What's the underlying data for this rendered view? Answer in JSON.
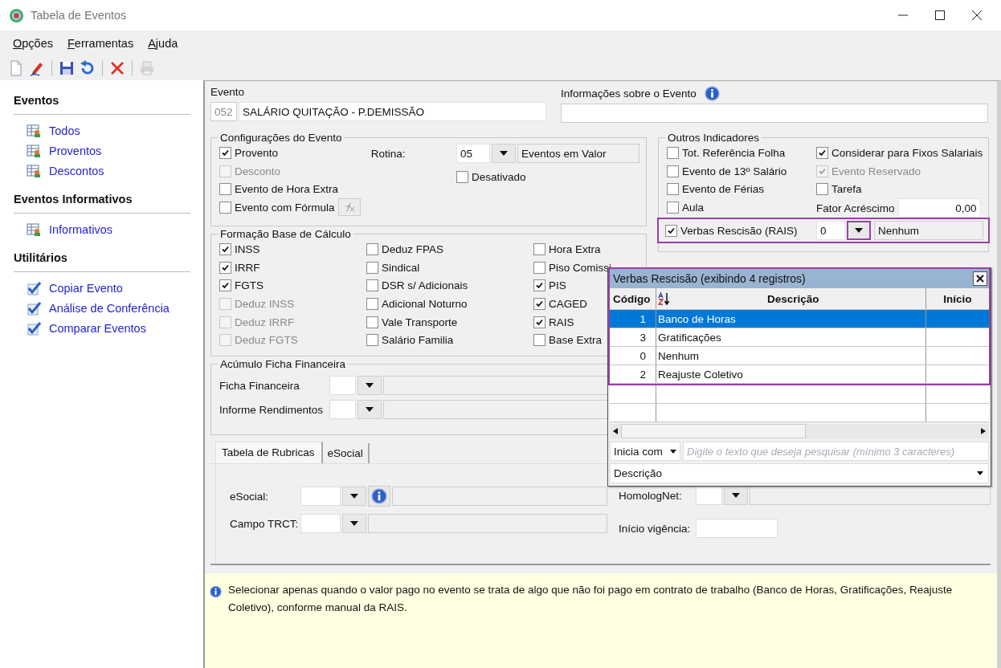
{
  "window": {
    "title": "Tabela de Eventos"
  },
  "menu": [
    "Opções",
    "Ferramentas",
    "Ajuda"
  ],
  "toolbar": [
    [
      {
        "kind": "new",
        "disabled": false
      },
      {
        "kind": "edit",
        "disabled": false
      }
    ],
    [
      {
        "kind": "save",
        "disabled": false
      },
      {
        "kind": "undo",
        "disabled": false
      }
    ],
    [
      {
        "kind": "delete",
        "disabled": false
      }
    ],
    [
      {
        "kind": "print",
        "disabled": true
      }
    ]
  ],
  "sidebar": [
    {
      "title": "Eventos",
      "items": [
        {
          "label": "Todos",
          "kind": "list"
        },
        {
          "label": "Proventos",
          "kind": "list"
        },
        {
          "label": "Descontos",
          "kind": "list"
        }
      ]
    },
    {
      "title": "Eventos Informativos",
      "items": [
        {
          "label": "Informativos",
          "kind": "list"
        }
      ]
    },
    {
      "title": "Utilitários",
      "items": [
        {
          "label": "Copiar Evento",
          "kind": "check"
        },
        {
          "label": "Análise de Conferência",
          "kind": "check"
        },
        {
          "label": "Comparar Eventos",
          "kind": "check"
        }
      ]
    }
  ],
  "evento": {
    "label": "Evento",
    "code": "052",
    "name": "SALÁRIO QUITAÇÃO - P.DEMISSÃO"
  },
  "info": {
    "label": "Informações sobre o Evento"
  },
  "config": {
    "title": "Configurações do Evento",
    "items": [
      {
        "label": "Provento",
        "checked": true,
        "disabled": false
      },
      {
        "label": "Desconto",
        "checked": false,
        "disabled": true
      },
      {
        "label": "Evento de Hora Extra",
        "checked": false,
        "disabled": false
      },
      {
        "label": "Evento com Fórmula",
        "checked": false,
        "disabled": false
      }
    ],
    "rotina": {
      "label": "Rotina:",
      "code": "05",
      "description": "Eventos em Valor"
    },
    "desativado": {
      "label": "Desativado",
      "checked": false,
      "disabled": false
    }
  },
  "base": {
    "title": "Formação Base de Cálculo",
    "columns": [
      [
        {
          "label": "INSS",
          "checked": true,
          "disabled": false
        },
        {
          "label": "IRRF",
          "checked": true,
          "disabled": false
        },
        {
          "label": "FGTS",
          "checked": true,
          "disabled": false
        },
        {
          "label": "Deduz INSS",
          "checked": false,
          "disabled": true
        },
        {
          "label": "Deduz IRRF",
          "checked": false,
          "disabled": true
        },
        {
          "label": "Deduz FGTS",
          "checked": false,
          "disabled": true
        }
      ],
      [
        {
          "label": "Deduz FPAS",
          "checked": false,
          "disabled": false
        },
        {
          "label": "Sindical",
          "checked": false,
          "disabled": false
        },
        {
          "label": "DSR s/ Adicionais",
          "checked": false,
          "disabled": false
        },
        {
          "label": "Adicional Noturno",
          "checked": false,
          "disabled": false
        },
        {
          "label": "Vale Transporte",
          "checked": false,
          "disabled": false
        },
        {
          "label": "Salário Familia",
          "checked": false,
          "disabled": false
        }
      ],
      [
        {
          "label": "Hora Extra",
          "checked": false,
          "disabled": false
        },
        {
          "label": "Piso Comissi",
          "checked": false,
          "disabled": false
        },
        {
          "label": "PIS",
          "checked": true,
          "disabled": false
        },
        {
          "label": "CAGED",
          "checked": true,
          "disabled": false
        },
        {
          "label": "RAIS",
          "checked": true,
          "disabled": false
        },
        {
          "label": "Base Extra",
          "checked": false,
          "disabled": false
        }
      ]
    ]
  },
  "acumulo": {
    "title": "Acúmulo Ficha Financeira",
    "rows": [
      {
        "label": "Ficha Financeira"
      },
      {
        "label": "Informe Rendimentos"
      }
    ]
  },
  "outros": {
    "title": "Outros Indicadores",
    "items": [
      {
        "label": "Tot. Referência Folha",
        "checked": false,
        "disabled": false
      },
      {
        "label": "Considerar para Fixos Salariais",
        "checked": true,
        "disabled": false
      },
      {
        "label": "Evento de 13º Salário",
        "checked": false,
        "disabled": false
      },
      {
        "label": "Evento Reservado",
        "checked": true,
        "disabled": true
      },
      {
        "label": "Evento de Férias",
        "checked": false,
        "disabled": false
      },
      {
        "label": "Tarefa",
        "checked": false,
        "disabled": false
      },
      {
        "label": "Aula",
        "checked": false,
        "disabled": false
      }
    ],
    "fator": {
      "label": "Fator Acréscimo",
      "value": "0,00"
    },
    "verbas": {
      "label": "Verbas Rescisão (RAIS)",
      "checked": true,
      "disabled": false,
      "code": "0",
      "description": "Nenhum",
      "highlighted": true
    }
  },
  "tabs": [
    {
      "label": "Tabela de Rubricas",
      "selected": true
    },
    {
      "label": "eSocial",
      "selected": false
    }
  ],
  "rubricas": {
    "esocial": "eSocial:",
    "trct": "Campo TRCT:",
    "homolognet": "HomologNet:",
    "vigencia": "Início vigência:"
  },
  "hint": "Selecionar apenas quando o valor pago no evento se trata de algo que não foi pago em contrato de trabalho (Banco de Horas, Gratificações, Reajuste Coletivo), conforme manual da RAIS.",
  "lookup": {
    "title": "Verbas Rescisão (exibindo 4 registros)",
    "highlighted": true,
    "columns": [
      "Código",
      "Descrição",
      "Início"
    ],
    "rows": [
      {
        "code": "1",
        "description": "Banco de Horas",
        "selected": true
      },
      {
        "code": "3",
        "description": "Gratificações",
        "selected": false
      },
      {
        "code": "0",
        "description": "Nenhum",
        "selected": false
      },
      {
        "code": "2",
        "description": "Reajuste Coletivo",
        "selected": false
      }
    ],
    "search_mode": "Inicia com",
    "search_placeholder": "Digite o texto que deseja pesquisar (mínimo 3 caracteres)",
    "search_field": "Descrição"
  }
}
